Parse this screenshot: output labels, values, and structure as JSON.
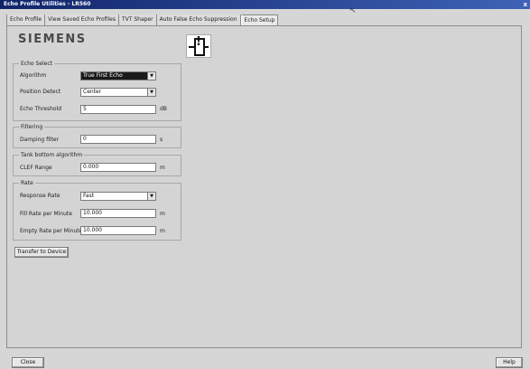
{
  "window": {
    "title": "Echo Profile Utilities - LR560"
  },
  "tabs": [
    {
      "label": "Echo Profile"
    },
    {
      "label": "View Saved Echo Profiles"
    },
    {
      "label": "TVT Shaper"
    },
    {
      "label": "Auto False Echo Suppression"
    },
    {
      "label": "Echo Setup"
    }
  ],
  "active_tab": "Echo Setup",
  "brand": {
    "logo_text": "SIEMENS"
  },
  "echo_select": {
    "title": "Echo Select",
    "algorithm": {
      "label": "Algorithm",
      "value": "True First Echo"
    },
    "position_detect": {
      "label": "Position Detect",
      "value": "Center"
    },
    "echo_threshold": {
      "label": "Echo Threshold",
      "value": "5",
      "unit": "dB"
    }
  },
  "filtering": {
    "title": "Filtering",
    "damping_filter": {
      "label": "Damping filter",
      "value": "0",
      "unit": "s"
    }
  },
  "tank_bottom": {
    "title": "Tank bottom algorithm",
    "clef_range": {
      "label": "CLEF Range",
      "value": "0.000",
      "unit": "m"
    }
  },
  "rate": {
    "title": "Rate",
    "response_rate": {
      "label": "Response Rate",
      "value": "Fast"
    },
    "fill_rate": {
      "label": "Fill Rate per Minute",
      "value": "10.000",
      "unit": "m"
    },
    "empty_rate": {
      "label": "Empty Rate per Minute",
      "value": "10.000",
      "unit": "m"
    }
  },
  "buttons": {
    "transfer": "Transfer to Device",
    "close": "Close",
    "help": "Help"
  }
}
